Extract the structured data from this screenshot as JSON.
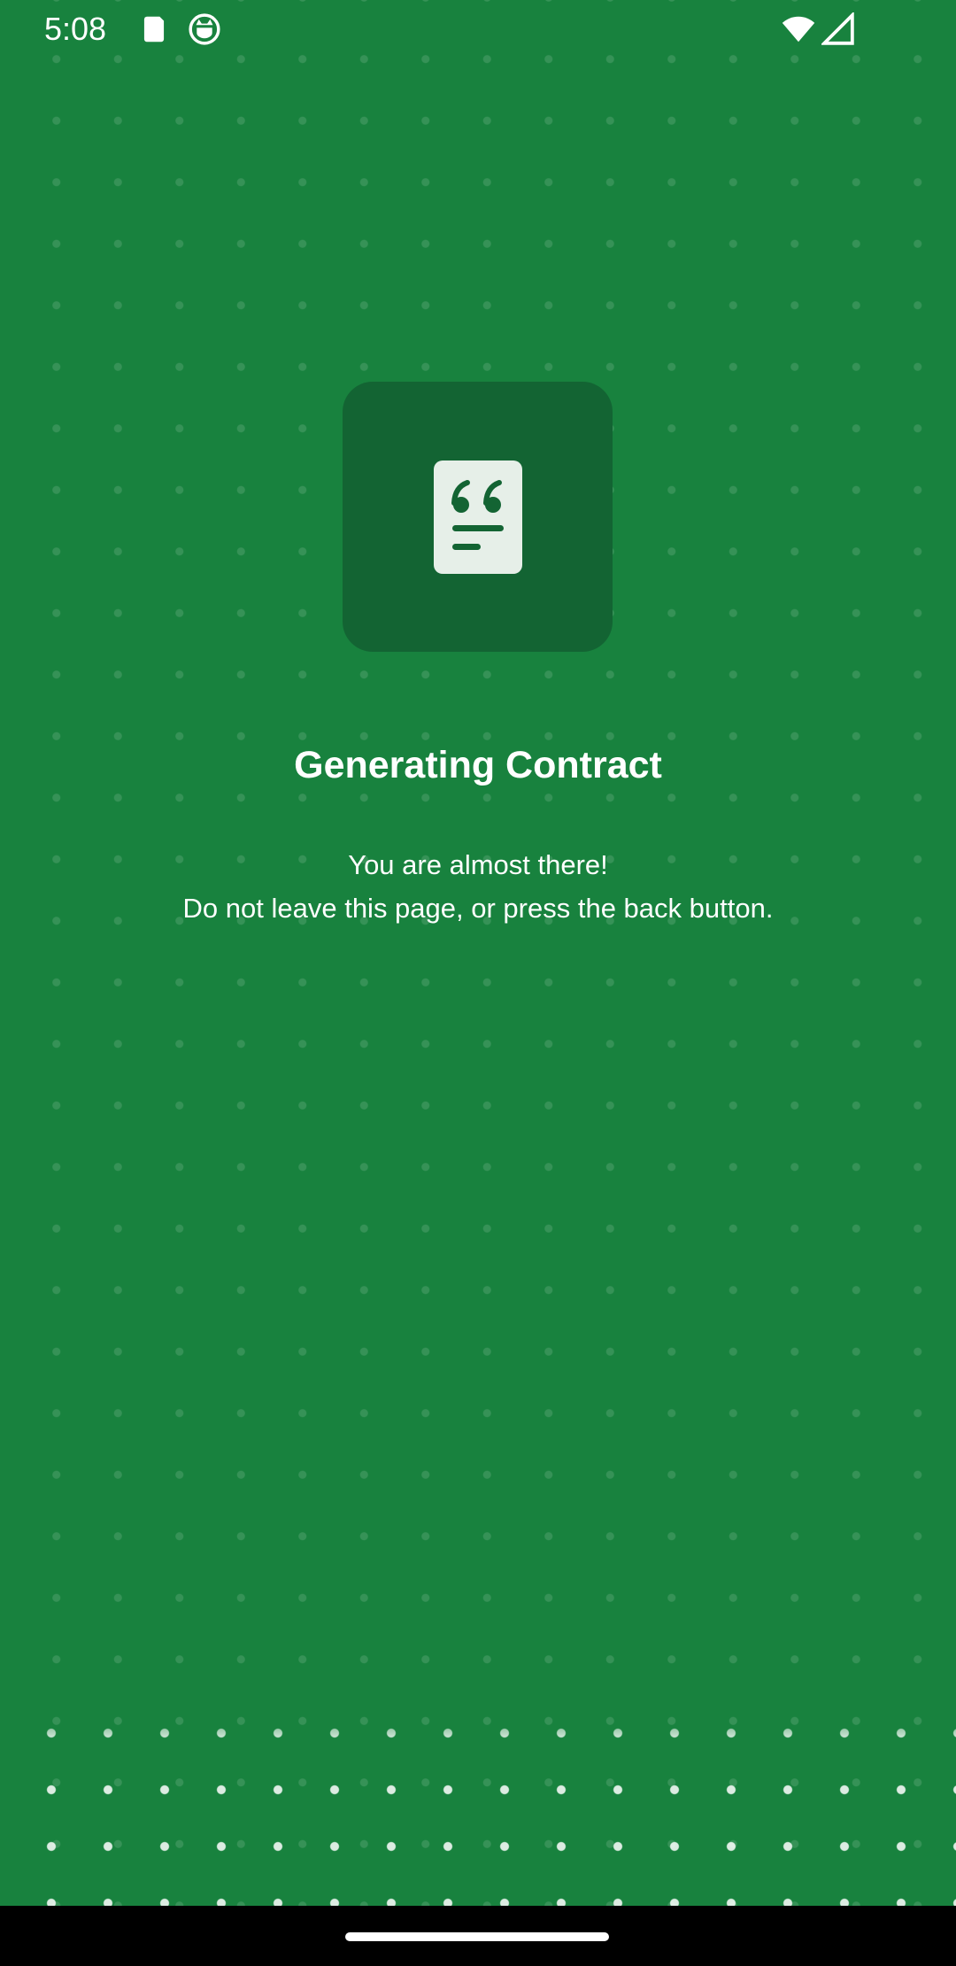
{
  "status_bar": {
    "time": "5:08",
    "icons": [
      "sim-card-icon",
      "cat-face-icon",
      "wifi-icon",
      "signal-icon"
    ]
  },
  "hero": {
    "icon": "quote-document-icon"
  },
  "title": "Generating Contract",
  "subtitle": {
    "line1": "You are almost there!",
    "line2": "Do not leave this page, or press the back button."
  },
  "colors": {
    "background": "#18823e",
    "tile": "#136433",
    "doc_paper": "#e6efe8",
    "text": "#ffffff"
  }
}
